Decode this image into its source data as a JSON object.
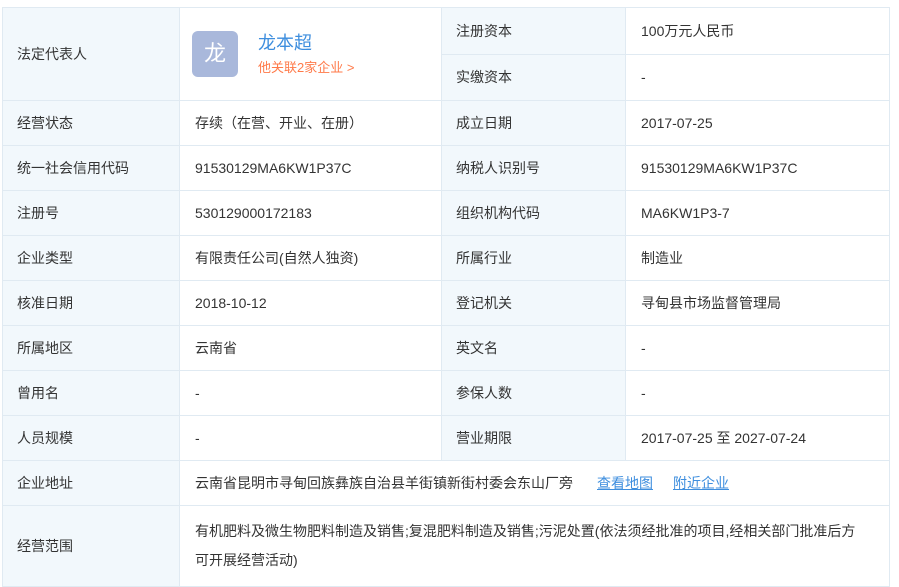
{
  "colors": {
    "border": "#e0eaf2",
    "label_bg": "#f2f8fc",
    "text": "#333333",
    "link_blue": "#3e8ede",
    "orange": "#ff7a49",
    "avatar_bg": "#a9b8db"
  },
  "table": {
    "legal_rep": {
      "label": "法定代表人",
      "avatar_char": "龙",
      "name": "龙本超",
      "related": "他关联2家企业 >"
    },
    "top_right": [
      {
        "label": "注册资本",
        "value": "100万元人民币"
      },
      {
        "label": "实缴资本",
        "value": "-"
      }
    ],
    "fields": [
      {
        "left": {
          "label": "经营状态",
          "value": "存续（在营、开业、在册）"
        },
        "right": {
          "label": "成立日期",
          "value": "2017-07-25"
        }
      },
      {
        "left": {
          "label": "统一社会信用代码",
          "value": "91530129MA6KW1P37C"
        },
        "right": {
          "label": "纳税人识别号",
          "value": "91530129MA6KW1P37C"
        }
      },
      {
        "left": {
          "label": "注册号",
          "value": "530129000172183"
        },
        "right": {
          "label": "组织机构代码",
          "value": "MA6KW1P3-7"
        }
      },
      {
        "left": {
          "label": "企业类型",
          "value": "有限责任公司(自然人独资)"
        },
        "right": {
          "label": "所属行业",
          "value": "制造业"
        }
      },
      {
        "left": {
          "label": "核准日期",
          "value": "2018-10-12"
        },
        "right": {
          "label": "登记机关",
          "value": "寻甸县市场监督管理局"
        }
      },
      {
        "left": {
          "label": "所属地区",
          "value": "云南省"
        },
        "right": {
          "label": "英文名",
          "value": "-"
        }
      },
      {
        "left": {
          "label": "曾用名",
          "value": "-"
        },
        "right": {
          "label": "参保人数",
          "value": "-"
        }
      },
      {
        "left": {
          "label": "人员规模",
          "value": "-"
        },
        "right": {
          "label": "营业期限",
          "value": "2017-07-25 至 2027-07-24"
        }
      }
    ],
    "address": {
      "label": "企业地址",
      "value": "云南省昆明市寻甸回族彝族自治县羊街镇新街村委会东山厂旁",
      "map_link": "查看地图",
      "nearby_link": "附近企业"
    },
    "scope": {
      "label": "经营范围",
      "value": "有机肥料及微生物肥料制造及销售;复混肥料制造及销售;污泥处置(依法须经批准的项目,经相关部门批准后方可开展经营活动)"
    }
  }
}
